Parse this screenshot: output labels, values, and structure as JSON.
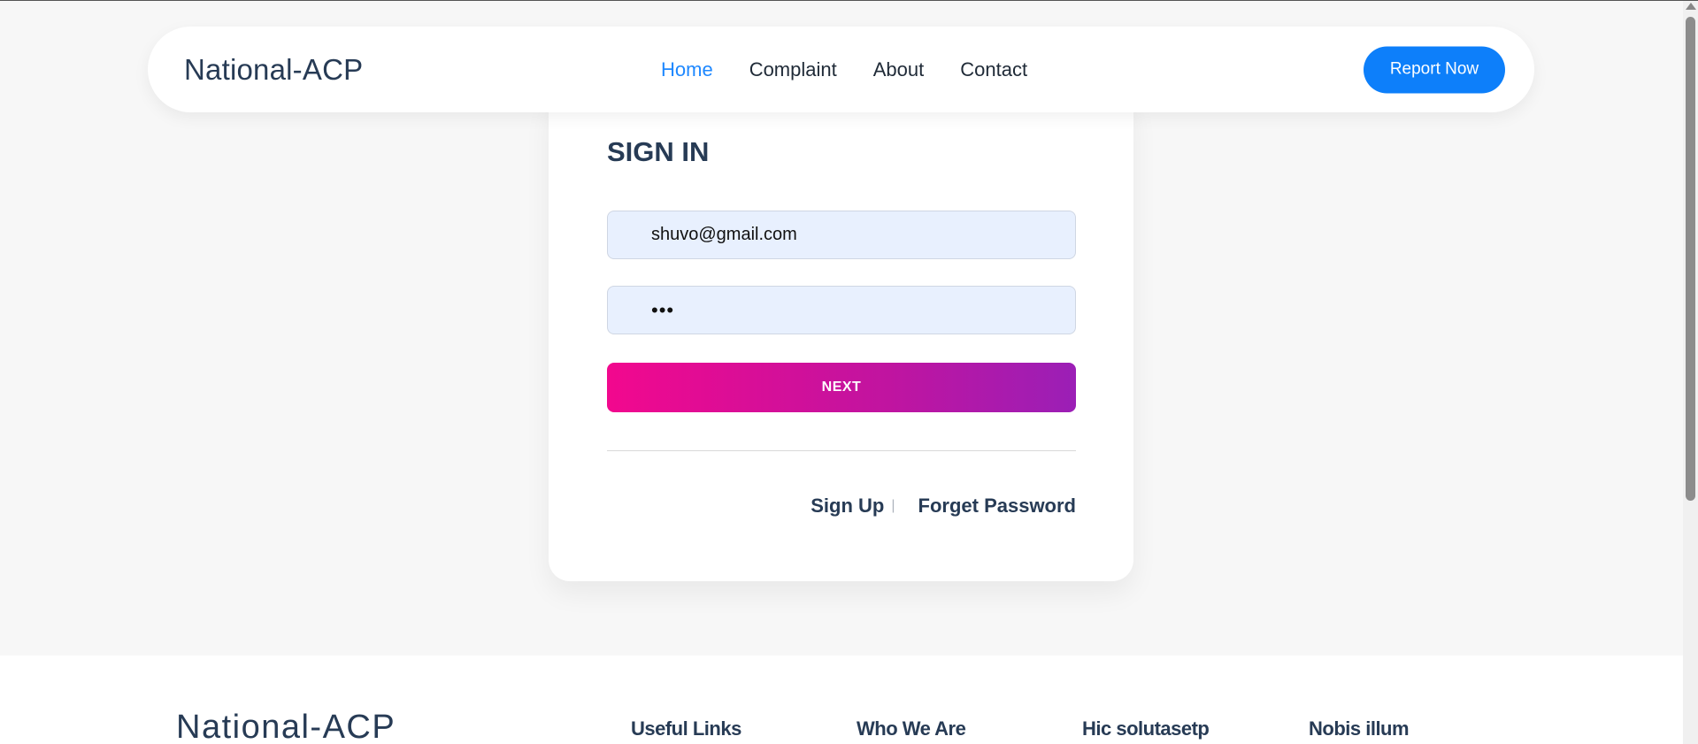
{
  "header": {
    "brand": "National-ACP",
    "nav": [
      {
        "label": "Home",
        "active": true
      },
      {
        "label": "Complaint",
        "active": false
      },
      {
        "label": "About",
        "active": false
      },
      {
        "label": "Contact",
        "active": false
      }
    ],
    "cta_label": "Report Now"
  },
  "signin": {
    "title": "SIGN IN",
    "email_value": "shuvo@gmail.com",
    "password_value": "•••",
    "next_label": "NEXT",
    "signup_label": "Sign Up",
    "separator": "|",
    "forgot_label": "Forget Password"
  },
  "footer": {
    "brand": "National-ACP",
    "columns": [
      "Useful Links",
      "Who We Are",
      "Hic solutasetp",
      "Nobis illum"
    ]
  },
  "colors": {
    "accent": "#0d7ffa",
    "nav_active": "#1e88ff",
    "text_dark": "#273b55",
    "next_gradient_start": "#f2088e",
    "next_gradient_end": "#9b1fb6",
    "input_bg": "#e8f0fe"
  }
}
